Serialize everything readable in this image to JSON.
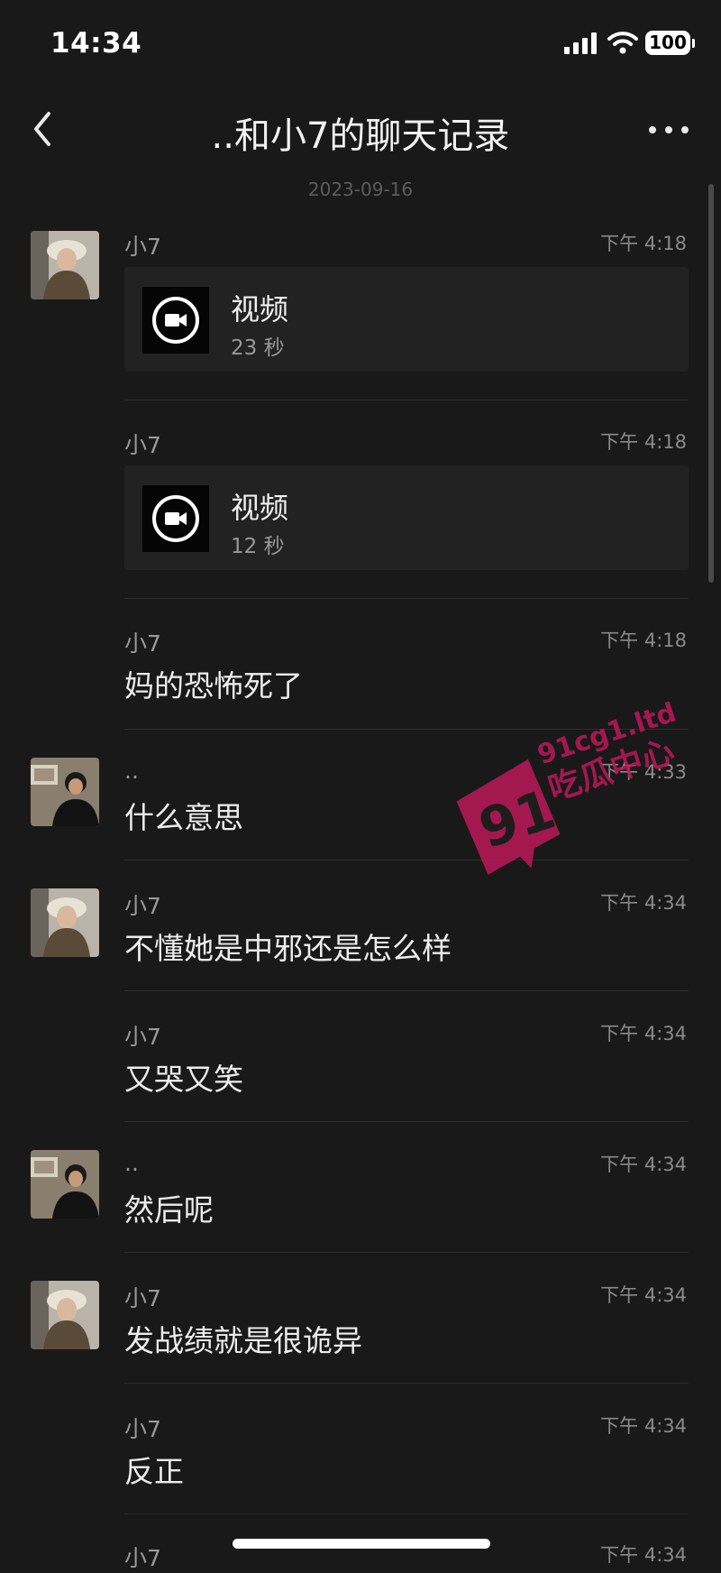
{
  "status_bar": {
    "time": "14:34",
    "battery": "100"
  },
  "nav": {
    "title": "..和小7的聊天记录"
  },
  "date_separator": "2023-09-16",
  "messages": [
    {
      "sender": "小7",
      "time": "下午 4:18",
      "type": "video",
      "video_label": "视频",
      "duration": "23 秒",
      "avatar": "girl-avatar"
    },
    {
      "sender": "小7",
      "time": "下午 4:18",
      "type": "video",
      "video_label": "视频",
      "duration": "12 秒"
    },
    {
      "sender": "小7",
      "time": "下午 4:18",
      "type": "text",
      "text": "妈的恐怖死了"
    },
    {
      "sender": "..",
      "time": "下午 4:33",
      "type": "text",
      "text": "什么意思",
      "avatar": "boy-avatar"
    },
    {
      "sender": "小7",
      "time": "下午 4:34",
      "type": "text",
      "text": "不懂她是中邪还是怎么样",
      "avatar": "girl-avatar"
    },
    {
      "sender": "小7",
      "time": "下午 4:34",
      "type": "text",
      "text": "又哭又笑"
    },
    {
      "sender": "..",
      "time": "下午 4:34",
      "type": "text",
      "text": "然后呢",
      "avatar": "boy-avatar"
    },
    {
      "sender": "小7",
      "time": "下午 4:34",
      "type": "text",
      "text": "发战绩就是很诡异",
      "avatar": "girl-avatar"
    },
    {
      "sender": "小7",
      "time": "下午 4:34",
      "type": "text",
      "text": "反正"
    },
    {
      "sender": "小7",
      "time": "下午 4:34",
      "type": "text",
      "text": ""
    }
  ],
  "watermark": {
    "number": "91",
    "domain": "91cg1.ltd",
    "brand": "吃瓜中心",
    "color": "#c2185b"
  },
  "colors": {
    "background": "#191919",
    "card": "#222222",
    "divider": "#2c2c2c"
  }
}
